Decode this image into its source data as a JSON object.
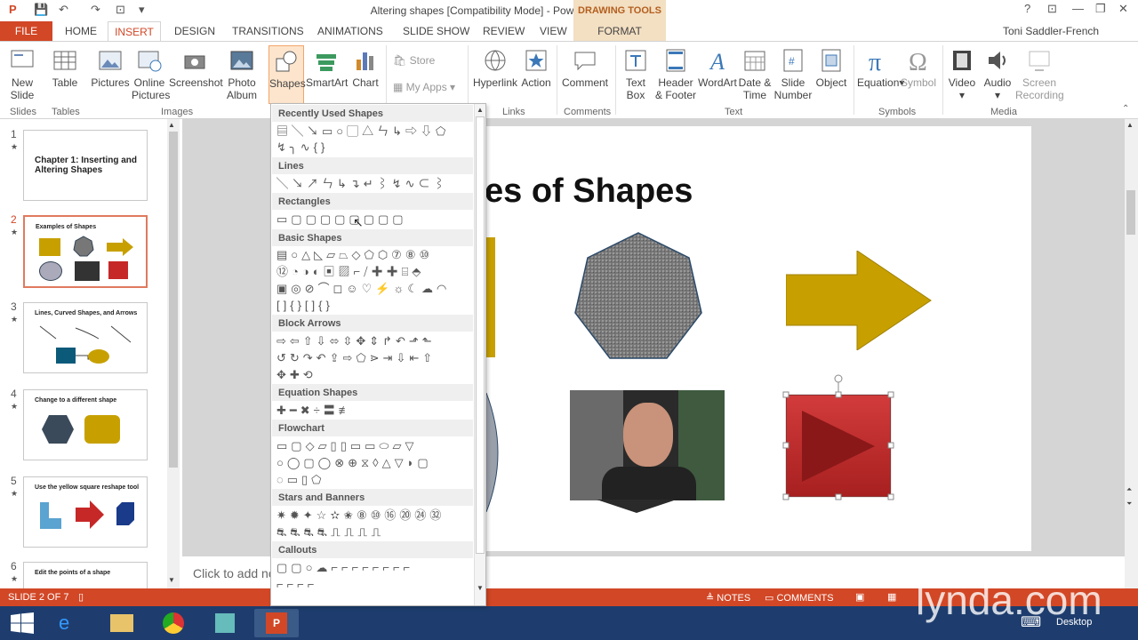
{
  "app": {
    "title": "Altering shapes [Compatibility Mode] - PowerPoint",
    "drawing_tools": "DRAWING TOOLS",
    "user": "Toni Saddler-French"
  },
  "tabs": [
    "FILE",
    "HOME",
    "INSERT",
    "DESIGN",
    "TRANSITIONS",
    "ANIMATIONS",
    "SLIDE SHOW",
    "REVIEW",
    "VIEW",
    "FORMAT"
  ],
  "ribbon": {
    "new_slide": [
      "New",
      "Slide"
    ],
    "table": "Table",
    "pictures": "Pictures",
    "online_pictures": [
      "Online",
      "Pictures"
    ],
    "screenshot": "Screenshot",
    "photo_album": [
      "Photo",
      "Album"
    ],
    "shapes": "Shapes",
    "smartart": "SmartArt",
    "chart": "Chart",
    "store": "Store",
    "my_apps": "My Apps",
    "hyperlink": "Hyperlink",
    "action": "Action",
    "comment": "Comment",
    "text_box": [
      "Text",
      "Box"
    ],
    "header_footer": [
      "Header",
      "& Footer"
    ],
    "wordart": "WordArt",
    "date_time": [
      "Date &",
      "Time"
    ],
    "slide_number": [
      "Slide",
      "Number"
    ],
    "object": "Object",
    "equation": "Equation",
    "symbol": "Symbol",
    "video": "Video",
    "audio": "Audio",
    "screen_recording": [
      "Screen",
      "Recording"
    ],
    "groups": {
      "slides": "Slides",
      "tables": "Tables",
      "images": "Images",
      "links": "Links",
      "comments": "Comments",
      "text": "Text",
      "symbols": "Symbols",
      "media": "Media"
    }
  },
  "thumbnails": [
    {
      "num": "1",
      "title": "Chapter 1: Inserting and Altering Shapes"
    },
    {
      "num": "2",
      "title": "Examples of Shapes"
    },
    {
      "num": "3",
      "title": "Lines, Curved Shapes, and Arrows"
    },
    {
      "num": "4",
      "title": "Change to a different shape"
    },
    {
      "num": "5",
      "title": "Use the yellow square reshape tool"
    },
    {
      "num": "6",
      "title": "Edit the points of a shape"
    }
  ],
  "slide": {
    "title_visible": "es of Shapes"
  },
  "notes_placeholder": "Click to add no",
  "status": {
    "slide": "SLIDE 2 OF 7",
    "notes": "NOTES",
    "comments": "COMMENTS"
  },
  "gallery": {
    "sections": [
      "Recently Used Shapes",
      "Lines",
      "Rectangles",
      "Basic Shapes",
      "Block Arrows",
      "Equation Shapes",
      "Flowchart",
      "Stars and Banners",
      "Callouts"
    ],
    "rows": [
      "▤╲↘▭○▢△ㄣ↳⇨⇩⬠",
      "↯╮∿{}",
      "╲↘↗ㄣ↳↴↵⌇↯∿⊂⌇",
      "▭▢▢▢▢▢▢▢▢",
      "▤○△◺▱⏢◇⬠⬡⑦⑧⑩",
      "⑫◔◑◐▣▨⌐⧸✚✚⌸⬘",
      "▣◎⊘⌒◻☺♡⚡☼☾☁◠",
      "[]{}[]{}",
      "⇨⇦⇧⇩⬄⇳✥⇕↱↶⬏⬑",
      "↺↻↷↶⇪⇨⬠⋗⇥⇩⇤⇧",
      "✥✚⟲",
      "✚━✖÷〓≢",
      "▭▢◇▱▯▯▭▭⬭▱▽",
      "○◯▢◯⊗⊕⧖◊△▽◗▢",
      "◌▭▯⬠",
      "✷✹✦☆✫✬⑧⑩⑯⑳㉔㉜",
      "⛐⛐⛐⛐⎍⎍⎍⎍",
      "▢▢○☁⌐⌐⌐⌐⌐⌐⌐⌐",
      "⌐⌐⌐⌐"
    ]
  },
  "watermark": "lynda.com",
  "taskbar_desktop": "Desktop",
  "colors": {
    "accent": "#d24726",
    "gold": "#c7a000",
    "ribbon_bg": "#ffffff"
  }
}
